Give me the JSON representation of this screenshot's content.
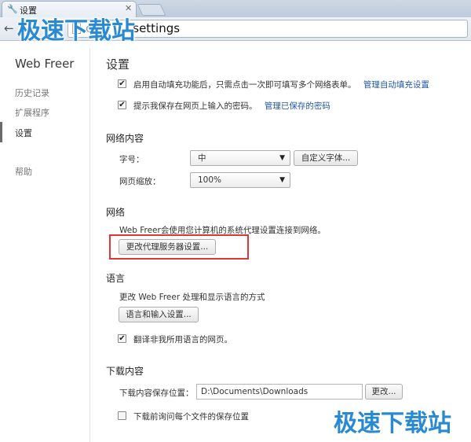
{
  "browser": {
    "tab_title": "设置",
    "url": "settings",
    "url_prefix": "c"
  },
  "sidebar": {
    "brand": "Web Freer",
    "items": [
      {
        "label": "历史记录"
      },
      {
        "label": "扩展程序"
      },
      {
        "label": "设置"
      },
      {
        "label": "帮助"
      }
    ]
  },
  "main": {
    "title": "设置",
    "autofill": {
      "text": "启用自动填充功能后，只需点击一次即可填写多个网络表单。",
      "link": "管理自动填充设置",
      "checked": true
    },
    "passwords": {
      "text": "提示我保存在网页上输入的密码。",
      "link": "管理已保存的密码",
      "checked": true
    },
    "web_content": {
      "title": "网络内容",
      "font_size_label": "字号：",
      "font_size_value": "中",
      "custom_fonts_button": "自定义字体...",
      "zoom_label": "网页缩放：",
      "zoom_value": "100%"
    },
    "network": {
      "title": "网络",
      "description": "Web Freer会使用您计算机的系统代理设置连接到网络。",
      "proxy_button": "更改代理服务器设置..."
    },
    "language": {
      "title": "语言",
      "description": "更改 Web Freer 处理和显示语言的方式",
      "settings_button": "语言和输入设置...",
      "translate_label": "翻译非我所用语言的网页。",
      "translate_checked": true
    },
    "downloads": {
      "title": "下载内容",
      "location_label": "下载内容保存位置：",
      "location_value": "D:\\Documents\\Downloads",
      "change_button": "更改...",
      "ask_label": "下载前询问每个文件的保存位置",
      "ask_checked": false
    }
  },
  "watermark": {
    "text": "极速下载站",
    "color": "#2a8ad1"
  },
  "colors": {
    "link": "#2457a8",
    "highlight_box": "#e03636"
  }
}
